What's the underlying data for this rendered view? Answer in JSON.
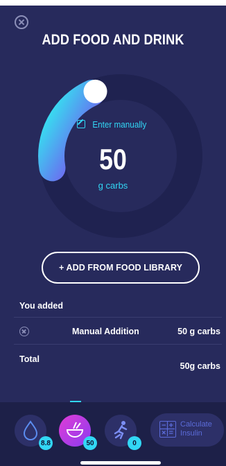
{
  "header": {
    "title": "ADD FOOD AND DRINK"
  },
  "dial": {
    "enter_manually": "Enter manually",
    "value": "50",
    "unit": "g carbs",
    "progress_fraction": 0.21
  },
  "actions": {
    "add_from_library": "+ ADD FROM FOOD LIBRARY"
  },
  "summary": {
    "heading": "You added",
    "items": [
      {
        "name": "Manual Addition",
        "amount": "50 g carbs"
      }
    ],
    "total_label": "Total",
    "total_value": "50g carbs"
  },
  "bottom_nav": {
    "glucose_badge": "8.8",
    "food_badge": "50",
    "activity_badge": "0",
    "calculate_label": "Calculate\nInsulin"
  },
  "colors": {
    "background": "#272a5c",
    "accent": "#32d7f5",
    "active_gradient_start": "#e13bd6",
    "active_gradient_end": "#8a3df0"
  }
}
